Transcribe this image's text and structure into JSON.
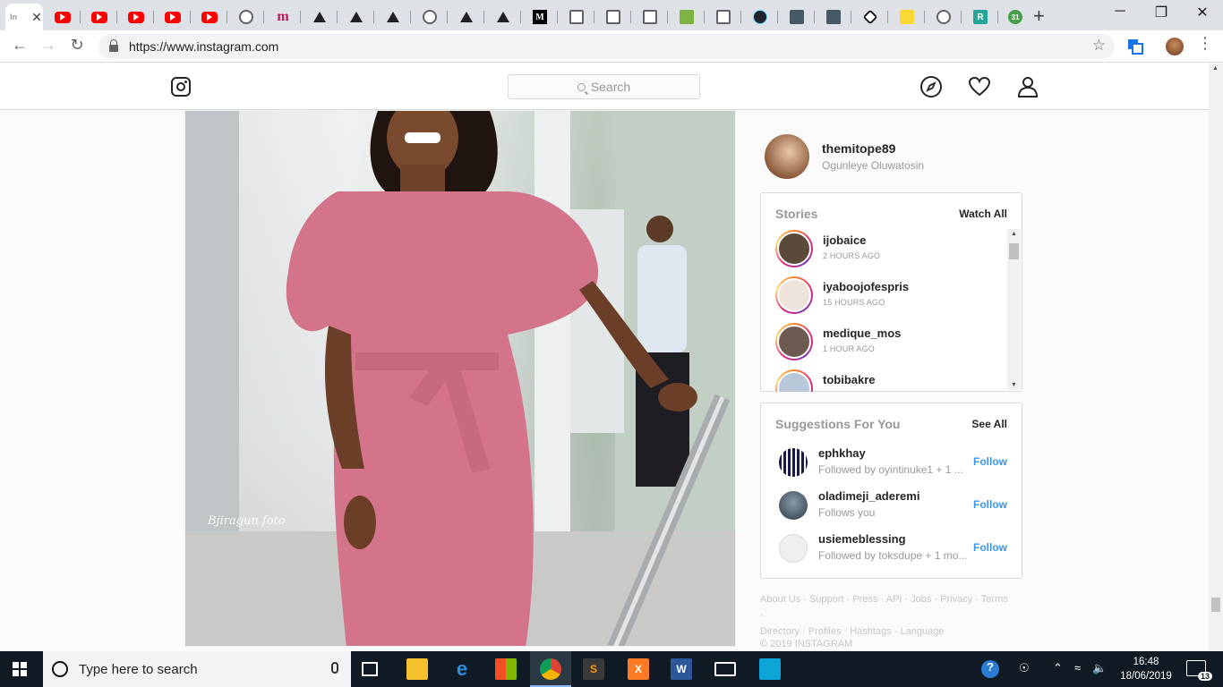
{
  "browser": {
    "active_tab_short": "In",
    "tab_close": "✕",
    "new_tab": "+",
    "url": "https://www.instagram.com",
    "window_buttons": {
      "minimize": "─",
      "restore": "❐",
      "close": "✕"
    },
    "tabs": [
      {
        "icon": "instagram-favicon"
      },
      {
        "icon": "youtube-icon"
      },
      {
        "icon": "youtube-icon"
      },
      {
        "icon": "youtube-icon"
      },
      {
        "icon": "youtube-icon"
      },
      {
        "icon": "youtube-icon"
      },
      {
        "icon": "globe-icon"
      },
      {
        "icon": "m-icon",
        "text": "m"
      },
      {
        "icon": "triangle-icon"
      },
      {
        "icon": "triangle-icon"
      },
      {
        "icon": "triangle-icon"
      },
      {
        "icon": "globe-icon"
      },
      {
        "icon": "triangle-icon"
      },
      {
        "icon": "triangle-icon"
      },
      {
        "icon": "medium-icon",
        "text": "M"
      },
      {
        "icon": "doc-icon"
      },
      {
        "icon": "doc-icon"
      },
      {
        "icon": "doc-icon"
      },
      {
        "icon": "w3-icon"
      },
      {
        "icon": "doc-icon"
      },
      {
        "icon": "react-icon"
      },
      {
        "icon": "floppy-icon"
      },
      {
        "icon": "floppy-icon"
      },
      {
        "icon": "codepen-icon"
      },
      {
        "icon": "zigzag-icon"
      },
      {
        "icon": "globe-icon"
      },
      {
        "icon": "rg-icon",
        "text": "R"
      },
      {
        "icon": "calendar-icon",
        "text": "31"
      }
    ]
  },
  "instagram": {
    "search_placeholder": "Search",
    "profile": {
      "username": "themitope89",
      "full_name": "Ogunleye Oluwatosin"
    },
    "stories": {
      "title": "Stories",
      "link": "Watch All",
      "items": [
        {
          "username": "ijobaice",
          "time": "2 HOURS AGO"
        },
        {
          "username": "iyaboojofespris",
          "time": "15 HOURS AGO"
        },
        {
          "username": "medique_mos",
          "time": "1 HOUR AGO"
        },
        {
          "username": "tobibakre",
          "time": ""
        }
      ]
    },
    "suggestions": {
      "title": "Suggestions For You",
      "link": "See All",
      "follow_label": "Follow",
      "items": [
        {
          "username": "ephkhay",
          "subtitle": "Followed by oyintinuke1 + 1 ..."
        },
        {
          "username": "oladimeji_aderemi",
          "subtitle": "Follows you"
        },
        {
          "username": "usiemeblessing",
          "subtitle": "Followed by toksdupe + 1 mo..."
        }
      ]
    },
    "footer": {
      "line1": "About Us · Support · Press · API · Jobs · Privacy · Terms ·",
      "line2": "Directory · Profiles · Hashtags · Language",
      "copyright": "© 2019 INSTAGRAM"
    },
    "photo_watermark": "Bjiragun foto"
  },
  "taskbar": {
    "search_placeholder": "Type here to search",
    "time": "16:48",
    "date": "18/06/2019",
    "notification_count": "13"
  }
}
